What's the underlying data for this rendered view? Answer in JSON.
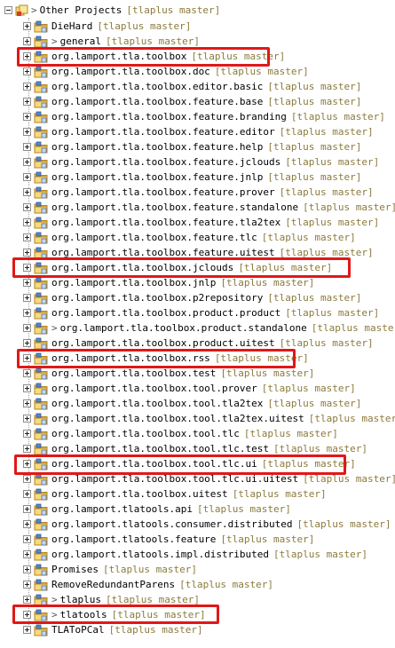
{
  "root": {
    "label": "Other Projects",
    "annotation": "[tlaplus master]"
  },
  "items": [
    {
      "label": "DieHard",
      "annotation": "[tlaplus master]",
      "prefix": ""
    },
    {
      "label": "general",
      "annotation": "[tlaplus master]",
      "prefix": ">"
    },
    {
      "label": "org.lamport.tla.toolbox",
      "annotation": "[tlaplus master]",
      "prefix": ""
    },
    {
      "label": "org.lamport.tla.toolbox.doc",
      "annotation": "[tlaplus master]",
      "prefix": ""
    },
    {
      "label": "org.lamport.tla.toolbox.editor.basic",
      "annotation": "[tlaplus master]",
      "prefix": ""
    },
    {
      "label": "org.lamport.tla.toolbox.feature.base",
      "annotation": "[tlaplus master]",
      "prefix": ""
    },
    {
      "label": "org.lamport.tla.toolbox.feature.branding",
      "annotation": "[tlaplus master]",
      "prefix": ""
    },
    {
      "label": "org.lamport.tla.toolbox.feature.editor",
      "annotation": "[tlaplus master]",
      "prefix": ""
    },
    {
      "label": "org.lamport.tla.toolbox.feature.help",
      "annotation": "[tlaplus master]",
      "prefix": ""
    },
    {
      "label": "org.lamport.tla.toolbox.feature.jclouds",
      "annotation": "[tlaplus master]",
      "prefix": ""
    },
    {
      "label": "org.lamport.tla.toolbox.feature.jnlp",
      "annotation": "[tlaplus master]",
      "prefix": ""
    },
    {
      "label": "org.lamport.tla.toolbox.feature.prover",
      "annotation": "[tlaplus master]",
      "prefix": ""
    },
    {
      "label": "org.lamport.tla.toolbox.feature.standalone",
      "annotation": "[tlaplus master]",
      "prefix": ""
    },
    {
      "label": "org.lamport.tla.toolbox.feature.tla2tex",
      "annotation": "[tlaplus master]",
      "prefix": ""
    },
    {
      "label": "org.lamport.tla.toolbox.feature.tlc",
      "annotation": "[tlaplus master]",
      "prefix": ""
    },
    {
      "label": "org.lamport.tla.toolbox.feature.uitest",
      "annotation": "[tlaplus master]",
      "prefix": ""
    },
    {
      "label": "org.lamport.tla.toolbox.jclouds",
      "annotation": "[tlaplus master]",
      "prefix": ""
    },
    {
      "label": "org.lamport.tla.toolbox.jnlp",
      "annotation": "[tlaplus master]",
      "prefix": ""
    },
    {
      "label": "org.lamport.tla.toolbox.p2repository",
      "annotation": "[tlaplus master]",
      "prefix": ""
    },
    {
      "label": "org.lamport.tla.toolbox.product.product",
      "annotation": "[tlaplus master]",
      "prefix": ""
    },
    {
      "label": "org.lamport.tla.toolbox.product.standalone",
      "annotation": "[tlaplus master]",
      "prefix": ">"
    },
    {
      "label": "org.lamport.tla.toolbox.product.uitest",
      "annotation": "[tlaplus master]",
      "prefix": ""
    },
    {
      "label": "org.lamport.tla.toolbox.rss",
      "annotation": "[tlaplus master]",
      "prefix": ""
    },
    {
      "label": "org.lamport.tla.toolbox.test",
      "annotation": "[tlaplus master]",
      "prefix": ""
    },
    {
      "label": "org.lamport.tla.toolbox.tool.prover",
      "annotation": "[tlaplus master]",
      "prefix": ""
    },
    {
      "label": "org.lamport.tla.toolbox.tool.tla2tex",
      "annotation": "[tlaplus master]",
      "prefix": ""
    },
    {
      "label": "org.lamport.tla.toolbox.tool.tla2tex.uitest",
      "annotation": "[tlaplus master]",
      "prefix": ""
    },
    {
      "label": "org.lamport.tla.toolbox.tool.tlc",
      "annotation": "[tlaplus master]",
      "prefix": ""
    },
    {
      "label": "org.lamport.tla.toolbox.tool.tlc.test",
      "annotation": "[tlaplus master]",
      "prefix": ""
    },
    {
      "label": "org.lamport.tla.toolbox.tool.tlc.ui",
      "annotation": "[tlaplus master]",
      "prefix": ""
    },
    {
      "label": "org.lamport.tla.toolbox.tool.tlc.ui.uitest",
      "annotation": "[tlaplus master]",
      "prefix": ""
    },
    {
      "label": "org.lamport.tla.toolbox.uitest",
      "annotation": "[tlaplus master]",
      "prefix": ""
    },
    {
      "label": "org.lamport.tlatools.api",
      "annotation": "[tlaplus master]",
      "prefix": ""
    },
    {
      "label": "org.lamport.tlatools.consumer.distributed",
      "annotation": "[tlaplus master]",
      "prefix": ""
    },
    {
      "label": "org.lamport.tlatools.feature",
      "annotation": "[tlaplus master]",
      "prefix": ""
    },
    {
      "label": "org.lamport.tlatools.impl.distributed",
      "annotation": "[tlaplus master]",
      "prefix": ""
    },
    {
      "label": "Promises",
      "annotation": "[tlaplus master]",
      "prefix": ""
    },
    {
      "label": "RemoveRedundantParens",
      "annotation": "[tlaplus master]",
      "prefix": ""
    },
    {
      "label": "tlaplus",
      "annotation": "[tlaplus master]",
      "prefix": ">"
    },
    {
      "label": "tlatools",
      "annotation": "[tlaplus master]",
      "prefix": ">"
    },
    {
      "label": "TLAToPCal",
      "annotation": "[tlaplus master]",
      "prefix": ""
    }
  ],
  "icon": "java-project-folder-icon",
  "colors": {
    "annotation": "#8b7a3c",
    "highlight": "#e01818"
  }
}
